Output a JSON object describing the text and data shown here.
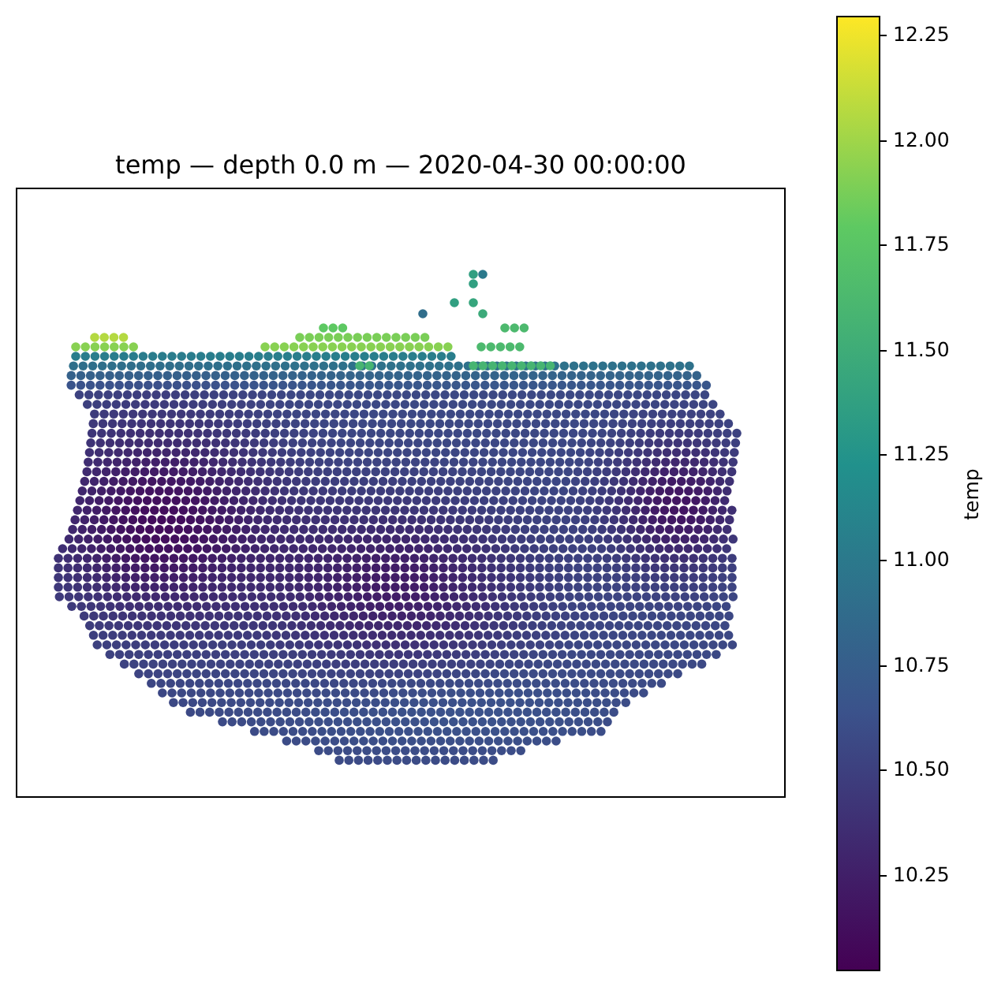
{
  "plot": {
    "title": "temp — depth 0.0 m — 2020-04-30 00:00:00"
  },
  "colorbar": {
    "label": "temp",
    "ticks": [
      "12.25",
      "12.00",
      "11.75",
      "11.50",
      "11.25",
      "11.00",
      "10.75",
      "10.50",
      "10.25"
    ]
  }
}
